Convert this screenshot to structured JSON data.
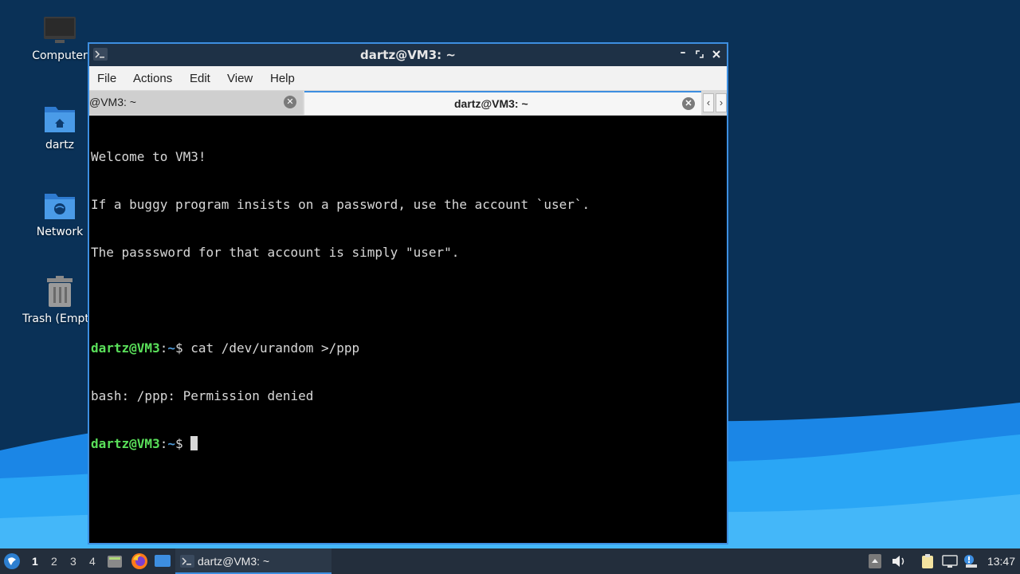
{
  "desktop": {
    "icons": [
      {
        "label": "Computer",
        "icon": "computer-icon"
      },
      {
        "label": "dartz",
        "icon": "home-folder-icon"
      },
      {
        "label": "Network",
        "icon": "network-folder-icon"
      },
      {
        "label": "Trash (Empt",
        "icon": "trash-icon"
      }
    ]
  },
  "window": {
    "title": "dartz@VM3: ~",
    "menu": [
      "File",
      "Actions",
      "Edit",
      "View",
      "Help"
    ],
    "tabs": [
      {
        "label": "@VM3: ~",
        "active": false
      },
      {
        "label": "dartz@VM3: ~",
        "active": true
      }
    ]
  },
  "terminal": {
    "lines": [
      "Welcome to VM3!",
      "If a buggy program insists on a password, use the account `user`.",
      "The passsword for that account is simply \"user\"."
    ],
    "prompt_user": "dartz@VM3",
    "prompt_sep": ":",
    "prompt_path": "~",
    "prompt_sym": "$ ",
    "command": "cat /dev/urandom >/ppp",
    "error": "bash: /ppp: Permission denied"
  },
  "taskbar": {
    "workspaces": [
      "1",
      "2",
      "3",
      "4"
    ],
    "task_label": "dartz@VM3: ~",
    "clock": "13:47"
  },
  "colors": {
    "accent": "#3d8ee0",
    "prompt_user": "#5ae05a",
    "prompt_path": "#4f9ad8"
  }
}
